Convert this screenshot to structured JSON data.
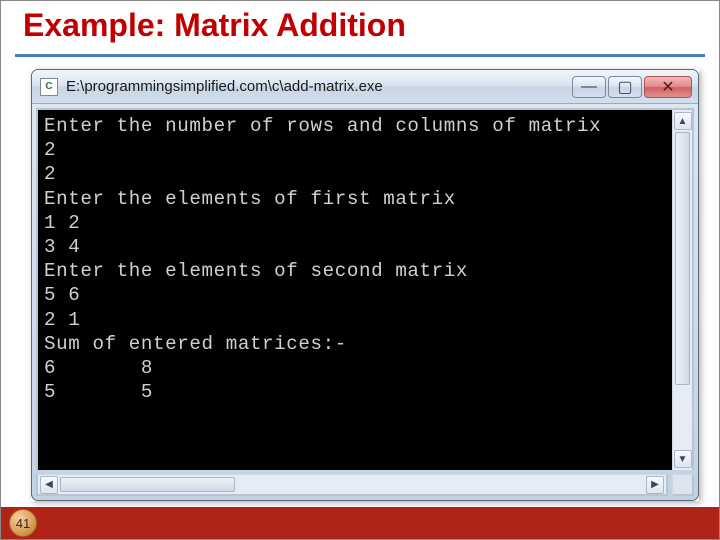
{
  "title": "Example: Matrix Addition",
  "window": {
    "icon_letter": "C",
    "title": "E:\\programmingsimplified.com\\c\\add-matrix.exe",
    "buttons": {
      "min": "—",
      "max": "▢",
      "close": "✕"
    }
  },
  "console_text": "Enter the number of rows and columns of matrix\n2\n2\nEnter the elements of first matrix\n1 2\n3 4\nEnter the elements of second matrix\n5 6\n2 1\nSum of entered matrices:-\n6       8\n5       5",
  "scroll": {
    "up": "▲",
    "down": "▼",
    "left": "◀",
    "right": "▶"
  },
  "slide_number": "41"
}
